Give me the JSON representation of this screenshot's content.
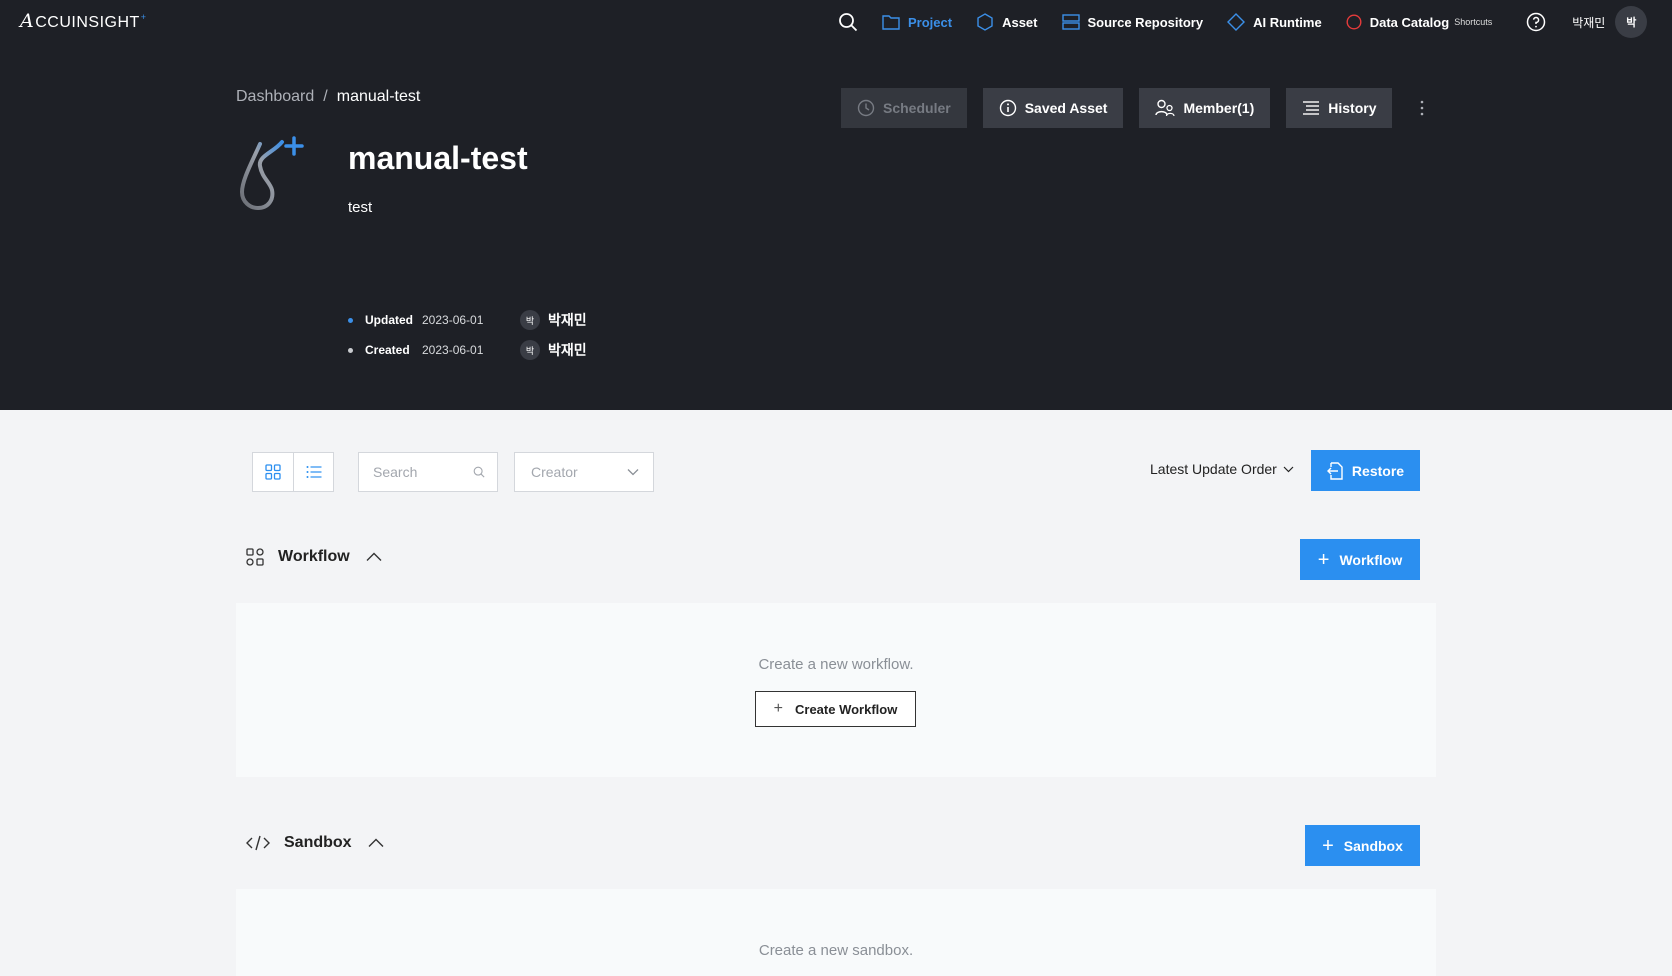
{
  "nav": {
    "logo": "CCUINSIGHT",
    "logo_mark": "A",
    "items": [
      {
        "label": "Project",
        "icon": "folder-icon"
      },
      {
        "label": "Asset",
        "icon": "hexagon-icon"
      },
      {
        "label": "Source Repository",
        "icon": "server-icon"
      },
      {
        "label": "AI Runtime",
        "icon": "diamond-icon"
      },
      {
        "label": "Data Catalog",
        "sub": "Shortcuts",
        "icon": "circle-icon"
      }
    ],
    "user_name": "박재민",
    "user_initial": "박"
  },
  "breadcrumb": {
    "root": "Dashboard",
    "sep": "/",
    "current": "manual-test"
  },
  "actions": {
    "scheduler": "Scheduler",
    "saved_asset": "Saved Asset",
    "member": "Member(1)",
    "history": "History"
  },
  "project": {
    "title": "manual-test",
    "description": "test",
    "updated_label": "Updated",
    "updated_date": "2023-06-01",
    "updated_by": "박재민",
    "created_label": "Created",
    "created_date": "2023-06-01",
    "created_by": "박재민",
    "user_initial": "박"
  },
  "toolbar": {
    "search_placeholder": "Search",
    "creator_placeholder": "Creator",
    "sort_label": "Latest Update Order",
    "restore_label": "Restore"
  },
  "workflow": {
    "title": "Workflow",
    "add_label": "Workflow",
    "empty_message": "Create a new workflow.",
    "create_label": "Create Workflow"
  },
  "sandbox": {
    "title": "Sandbox",
    "add_label": "Sandbox",
    "empty_message": "Create a new sandbox."
  },
  "colors": {
    "accent": "#2b8ff0",
    "dark_bg": "#1e2026",
    "button_bg": "#3a3d45",
    "page_bg": "#f3f4f6"
  }
}
